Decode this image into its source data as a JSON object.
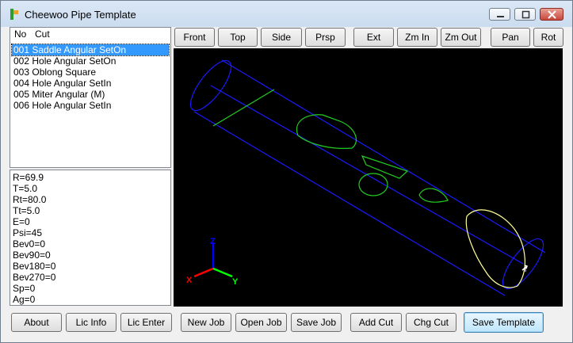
{
  "window": {
    "title": "Cheewoo Pipe Template"
  },
  "list": {
    "header_no": "No",
    "header_cut": "Cut",
    "items": [
      "001 Saddle Angular SetOn",
      "002 Hole Angular SetOn",
      "003 Oblong Square",
      "004 Hole Angular SetIn",
      "005 Miter Angular (M)",
      "006 Hole Angular SetIn"
    ],
    "selected_index": 0
  },
  "params": [
    "R=69.9",
    "T=5.0",
    "Rt=80.0",
    "Tt=5.0",
    "E=0",
    "Psi=45",
    "Bev0=0",
    "Bev90=0",
    "Bev180=0",
    "Bev270=0",
    "Sp=0",
    "Ag=0"
  ],
  "view_toolbar": [
    "Front",
    "Top",
    "Side",
    "Prsp",
    "Ext",
    "Zm In",
    "Zm Out",
    "Pan",
    "Rot"
  ],
  "bottom_buttons": [
    "About",
    "Lic Info",
    "Lic Enter",
    "New Job",
    "Open Job",
    "Save Job",
    "Add Cut",
    "Chg Cut",
    "Save Template"
  ],
  "axes": {
    "x": "X",
    "y": "Y",
    "z": "Z"
  },
  "colors": {
    "pipe": "#1a1aff",
    "cuts": "#22cc22",
    "selected_cut": "#ffff99",
    "axis_x": "#ff0000",
    "axis_y": "#00ff00",
    "axis_z": "#0000ff"
  }
}
